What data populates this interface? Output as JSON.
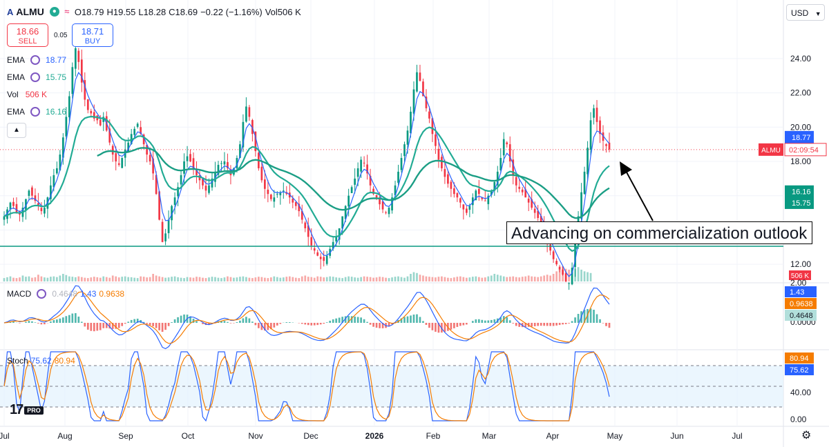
{
  "header": {
    "ticker_logo": "A",
    "ticker": "ALMU",
    "dot_icon": "circle-dot-icon",
    "wave_icon": "wave-icon",
    "open": "O18.79",
    "high": "H19.55",
    "low": "L18.28",
    "close": "C18.69",
    "change": "−0.22 (−1.16%)",
    "volume": "Vol506 K"
  },
  "trade": {
    "sell_price": "18.66",
    "sell_label": "SELL",
    "buy_price": "18.71",
    "buy_label": "BUY",
    "spread": "0.05"
  },
  "indicators": [
    {
      "name": "EMA",
      "value": "18.77",
      "color": "#2962ff"
    },
    {
      "name": "EMA",
      "value": "15.75",
      "color": "#22ab94"
    },
    {
      "name": "Vol",
      "value": "506 K",
      "color": "#f23645"
    },
    {
      "name": "EMA",
      "value": "16.16",
      "color": "#22ab94"
    }
  ],
  "macd_legend": {
    "name": "MACD",
    "hist": "0.4648",
    "macd": "1.43",
    "signal": "0.9638"
  },
  "stoch_legend": {
    "name": "Stoch",
    "k": "75.62",
    "d": "80.94"
  },
  "currency": "USD",
  "callout_text": "Advancing on commercialization outlook",
  "tv_logo": {
    "mark": "17",
    "pro": "PRO"
  },
  "settings_icon": "⚙",
  "chart_data": {
    "type": "candlestick",
    "x_labels": [
      "Jul",
      "Aug",
      "Sep",
      "Oct",
      "Nov",
      "Dec",
      "2026",
      "Feb",
      "Mar",
      "Apr",
      "May",
      "Jun",
      "Jul"
    ],
    "price_axis": {
      "ticks": [
        "12.00",
        "14.00",
        "16.00",
        "18.00",
        "20.00",
        "22.00",
        "24.00"
      ],
      "range": [
        11,
        25
      ]
    },
    "price_labels": [
      {
        "value": 18.77,
        "text": "18.77",
        "color": "#2962ff"
      },
      {
        "value": 16.16,
        "text": "16.16",
        "color": "#089981"
      },
      {
        "value": 15.75,
        "text": "15.75",
        "color": "#089981"
      },
      {
        "value": 18.69,
        "text": "ALMU",
        "extra": "02:09:54",
        "color": "#f23645"
      }
    ],
    "horizontal_line": {
      "value": 13.05,
      "color": "#089981"
    },
    "volume_label": "506 K",
    "macd_axis": {
      "ticks": [
        "2.00",
        "0.0000"
      ]
    },
    "macd_labels": [
      {
        "text": "1.43",
        "color": "#2962ff"
      },
      {
        "text": "0.9638",
        "color": "#f57c00"
      },
      {
        "text": "0.4648",
        "color": "#b2dfdb"
      }
    ],
    "stoch_axis": {
      "ticks": [
        "40.00",
        "0.00"
      ]
    },
    "stoch_labels": [
      {
        "text": "80.94",
        "color": "#f57c00"
      },
      {
        "text": "75.62",
        "color": "#2962ff"
      }
    ],
    "stoch_levels": [
      80,
      50,
      20
    ],
    "close_series": [
      14.8,
      15.2,
      15.6,
      15.4,
      15.0,
      14.9,
      15.3,
      15.8,
      16.3,
      16.0,
      15.7,
      15.4,
      15.1,
      15.3,
      15.9,
      16.6,
      17.2,
      17.6,
      18.4,
      19.4,
      20.6,
      21.8,
      23.5,
      24.6,
      23.8,
      22.6,
      21.6,
      21.0,
      20.8,
      20.5,
      20.4,
      20.1,
      20.6,
      19.8,
      19.1,
      18.4,
      18.0,
      17.8,
      18.2,
      18.7,
      19.1,
      19.6,
      19.9,
      20.2,
      19.6,
      19.0,
      18.4,
      18.0,
      17.3,
      16.1,
      14.6,
      13.3,
      13.8,
      14.6,
      15.4,
      15.9,
      16.5,
      17.2,
      18.0,
      18.3,
      18.0,
      17.6,
      17.2,
      16.9,
      16.6,
      16.3,
      16.6,
      17.0,
      17.4,
      17.8,
      17.9,
      18.0,
      17.6,
      17.2,
      17.6,
      18.2,
      19.0,
      20.3,
      21.2,
      20.6,
      19.6,
      18.6,
      17.6,
      16.9,
      16.4,
      16.1,
      15.8,
      15.9,
      16.1,
      16.2,
      16.3,
      16.1,
      15.9,
      15.6,
      15.4,
      15.1,
      14.6,
      14.1,
      13.6,
      13.1,
      12.8,
      12.5,
      12.3,
      12.2,
      12.5,
      12.9,
      13.3,
      13.6,
      14.1,
      14.8,
      15.4,
      16.0,
      16.5,
      17.0,
      17.6,
      18.1,
      17.9,
      17.3,
      16.6,
      16.1,
      15.9,
      15.5,
      15.2,
      15.0,
      15.3,
      15.9,
      16.6,
      17.4,
      18.2,
      19.0,
      19.8,
      20.9,
      22.2,
      23.2,
      22.7,
      21.8,
      21.1,
      20.5,
      19.6,
      18.9,
      18.1,
      17.6,
      17.1,
      16.7,
      16.4,
      16.1,
      15.9,
      15.6,
      15.2,
      15.0,
      15.4,
      15.9,
      16.3,
      16.1,
      15.8,
      15.7,
      16.0,
      16.3,
      16.8,
      17.4,
      18.2,
      19.3,
      19.0,
      18.0,
      17.2,
      16.6,
      16.4,
      16.2,
      15.9,
      15.6,
      15.3,
      15.0,
      14.7,
      14.3,
      13.8,
      13.3,
      12.8,
      12.3,
      12.0,
      11.7,
      11.4,
      11.0,
      10.9,
      11.8,
      13.3,
      14.8,
      16.2,
      17.4,
      18.8,
      20.4,
      21.1,
      20.3,
      19.6,
      19.2,
      18.9,
      18.69
    ],
    "volume_series": [
      0.2,
      0.25,
      0.3,
      0.22,
      0.2,
      0.24,
      0.35,
      0.28,
      0.3,
      0.22,
      0.25,
      0.4,
      0.3,
      0.24,
      0.22,
      0.28,
      0.3,
      0.26,
      0.35,
      0.45,
      0.38,
      0.3,
      0.28,
      0.25,
      0.3,
      0.26,
      0.22,
      0.2,
      0.24,
      0.28,
      0.25,
      0.22,
      0.3,
      0.26,
      0.22,
      0.35,
      0.3,
      0.24,
      0.28,
      0.3,
      0.26,
      0.25,
      0.22,
      0.2,
      0.3,
      0.28,
      0.24,
      0.26,
      0.45,
      0.35,
      0.3,
      0.26,
      0.22,
      0.24,
      0.28,
      0.3,
      0.25,
      0.22,
      0.2,
      0.26,
      0.24,
      0.22,
      0.28,
      0.26,
      0.22,
      0.2,
      0.24,
      0.28,
      0.26,
      0.22,
      0.2,
      0.24,
      0.3,
      0.26,
      0.22,
      0.24,
      0.28,
      0.3,
      0.26,
      0.22,
      0.2,
      0.24,
      0.28,
      0.26,
      0.22,
      0.2,
      0.24,
      0.3,
      0.26,
      0.22,
      0.24,
      0.28,
      0.3,
      0.26,
      0.22,
      0.2,
      0.3,
      0.35,
      0.28,
      0.26,
      0.22,
      0.3,
      0.28,
      0.24,
      0.26,
      0.3,
      0.28,
      0.24,
      0.22,
      0.2,
      0.26,
      0.3,
      0.28,
      0.24,
      0.22,
      0.26,
      0.3,
      0.28,
      0.26,
      0.22,
      0.24,
      0.28,
      0.26,
      0.22,
      0.2,
      0.24,
      0.28,
      0.3,
      0.26,
      0.22,
      0.3,
      0.45,
      0.55,
      0.5,
      0.4,
      0.35,
      0.3,
      0.28,
      0.26,
      0.24,
      0.28,
      0.3,
      0.26,
      0.22,
      0.2,
      0.24,
      0.28,
      0.3,
      0.26,
      0.22,
      0.24,
      0.28,
      0.3,
      0.26,
      0.22,
      0.24,
      0.3,
      0.35,
      0.45,
      0.4,
      0.35,
      0.3,
      0.26,
      0.28,
      0.3,
      0.26,
      0.24,
      0.28,
      0.3,
      0.35,
      0.3,
      0.28,
      0.26,
      0.3,
      0.35,
      0.4,
      0.35,
      0.45,
      0.6,
      0.8,
      0.9,
      0.75,
      0.7,
      0.65,
      0.75,
      0.85,
      0.7,
      0.6,
      0.55,
      0.5
    ]
  }
}
